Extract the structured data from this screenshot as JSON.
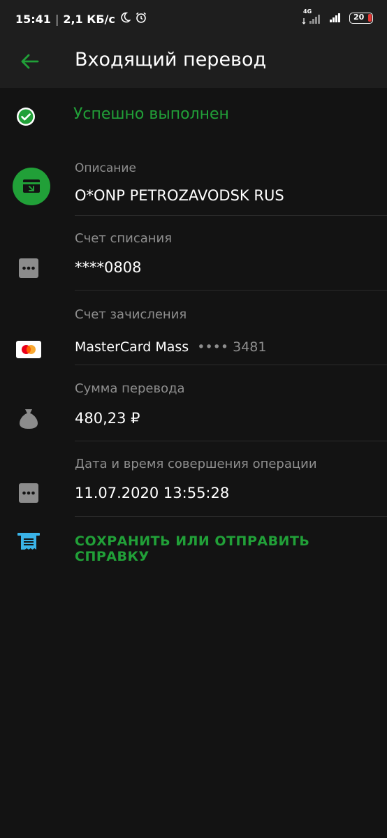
{
  "status_bar": {
    "time": "15:41",
    "separator": "|",
    "speed": "2,1 КБ/с",
    "network_type": "4G",
    "battery": "20",
    "icons": [
      "moon-icon",
      "alarm-icon",
      "signal-icon",
      "signal-icon",
      "battery-icon"
    ]
  },
  "app_bar": {
    "title": "Входящий перевод",
    "back_icon": "arrow-left-icon"
  },
  "status": {
    "text": "Успешно выполнен",
    "icon": "check-circle-icon"
  },
  "fields": [
    {
      "label": "Описание",
      "value": "O*ONP PETROZAVODSK RUS",
      "icon": "card-in-icon"
    },
    {
      "label": "Счет списания",
      "value": "****0808",
      "icon": "dots-icon"
    },
    {
      "label": "Счет зачисления",
      "value": "MasterCard Mass",
      "value_masked": "•••• 3481",
      "icon": "mastercard-icon"
    },
    {
      "label": "Сумма перевода",
      "value": "480,23 ₽",
      "icon": "money-bag-icon"
    },
    {
      "label": "Дата и время совершения операции",
      "value": "11.07.2020 13:55:28",
      "icon": "dots-icon"
    }
  ],
  "action": {
    "text": "СОХРАНИТЬ ИЛИ ОТПРАВИТЬ СПРАВКУ",
    "icon": "receipt-icon"
  },
  "colors": {
    "accent_green": "#21a038",
    "background": "#131313",
    "header": "#1e1e1e",
    "label_gray": "#8e8e8e",
    "receipt_blue": "#3ab3e8"
  }
}
